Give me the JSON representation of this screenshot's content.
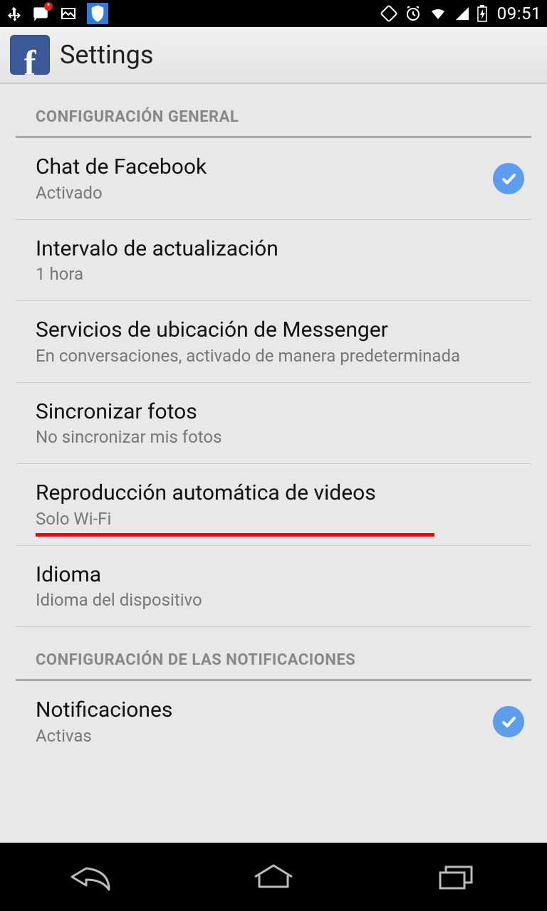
{
  "status_bar": {
    "time": "09:51"
  },
  "action_bar": {
    "title": "Settings"
  },
  "sections": [
    {
      "header": "CONFIGURACIÓN GENERAL",
      "items": [
        {
          "title": "Chat de Facebook",
          "subtitle": "Activado",
          "checked": true
        },
        {
          "title": "Intervalo de actualización",
          "subtitle": "1 hora",
          "checked": false
        },
        {
          "title": "Servicios de ubicación de Messenger",
          "subtitle": "En conversaciones, activado de manera predeterminada",
          "checked": false
        },
        {
          "title": "Sincronizar fotos",
          "subtitle": "No sincronizar mis fotos",
          "checked": false
        },
        {
          "title": "Reproducción automática de videos",
          "subtitle": "Solo Wi-Fi",
          "checked": false,
          "annotated": true
        },
        {
          "title": "Idioma",
          "subtitle": "Idioma del dispositivo",
          "checked": false
        }
      ]
    },
    {
      "header": "CONFIGURACIÓN DE LAS NOTIFICACIONES",
      "items": [
        {
          "title": "Notificaciones",
          "subtitle": "Activas",
          "checked": true
        }
      ]
    }
  ]
}
